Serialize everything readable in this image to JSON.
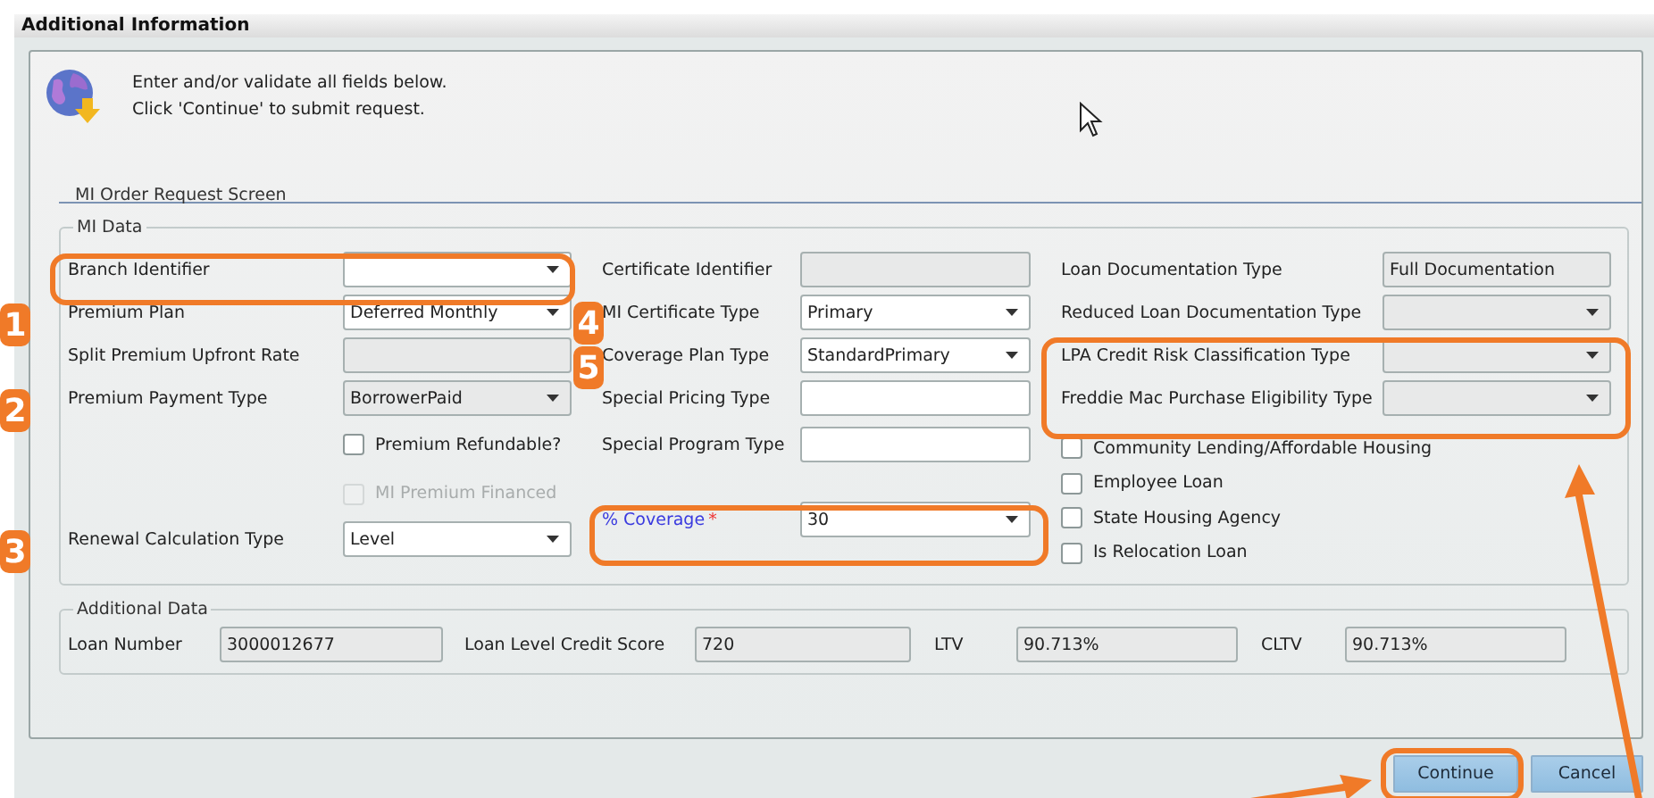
{
  "window": {
    "title": "Additional Information"
  },
  "instructions": [
    "Enter and/or validate all fields below.",
    "Click 'Continue' to submit request."
  ],
  "tab": {
    "label": "MI Order Request Screen"
  },
  "mi_data": {
    "legend": "MI Data",
    "columns": [
      [
        {
          "kind": "select",
          "label": "Branch Identifier",
          "disabled": false
        },
        {
          "kind": "select",
          "label": "Premium Plan",
          "value": "Deferred Monthly",
          "disabled": false
        },
        {
          "kind": "display",
          "label": "Split Premium Upfront Rate"
        },
        {
          "kind": "select",
          "label": "Premium Payment Type",
          "value": "BorrowerPaid",
          "disabled": true
        },
        {
          "kind": "checkbox",
          "label": "Premium Refundable?",
          "checked": false,
          "disabled": false
        },
        {
          "kind": "checkbox",
          "label": "MI Premium Financed",
          "checked": false,
          "disabled": true
        },
        {
          "kind": "select",
          "label": "Renewal Calculation Type",
          "value": "Level",
          "disabled": false
        }
      ],
      [
        {
          "kind": "display",
          "label": "Certificate Identifier"
        },
        {
          "kind": "select",
          "label": "MI Certificate Type",
          "value": "Primary",
          "disabled": false
        },
        {
          "kind": "select",
          "label": "Coverage Plan Type",
          "value": "StandardPrimary",
          "disabled": false
        },
        {
          "kind": "input",
          "label": "Special Pricing Type"
        },
        {
          "kind": "input",
          "label": "Special Program Type"
        },
        {
          "kind": "select",
          "label": "% Coverage",
          "required_mark": "*",
          "value": "30",
          "disabled": false
        }
      ],
      [
        {
          "kind": "display",
          "label": "Loan Documentation Type",
          "value": "Full Documentation"
        },
        {
          "kind": "select",
          "label": "Reduced Loan Documentation Type",
          "disabled": true
        },
        {
          "kind": "select",
          "label": "LPA Credit Risk Classification Type",
          "disabled": true
        },
        {
          "kind": "select",
          "label": "Freddie Mac Purchase Eligibility Type",
          "disabled": true
        },
        {
          "kind": "checkbox",
          "label": "Community Lending/Affordable Housing",
          "checked": false,
          "disabled": false
        },
        {
          "kind": "checkbox",
          "label": "Employee Loan",
          "checked": false,
          "disabled": false
        },
        {
          "kind": "checkbox",
          "label": "State Housing Agency",
          "checked": false,
          "disabled": false
        },
        {
          "kind": "checkbox",
          "label": "Is Relocation Loan",
          "checked": false,
          "disabled": false
        }
      ]
    ]
  },
  "additional_data": {
    "legend": "Additional Data",
    "fields": [
      {
        "label": "Loan Number",
        "value": "3000012677"
      },
      {
        "label": "Loan Level Credit Score",
        "value": "720"
      },
      {
        "label": "LTV",
        "value": "90.713%"
      },
      {
        "label": "CLTV",
        "value": "90.713%"
      }
    ]
  },
  "buttons": [
    {
      "label": "Continue"
    },
    {
      "label": "Cancel"
    }
  ],
  "annotations": {
    "badges": [
      "1",
      "2",
      "3",
      "4",
      "5"
    ]
  }
}
